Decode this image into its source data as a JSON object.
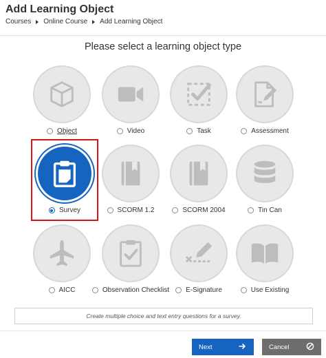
{
  "header": {
    "title": "Add Learning Object",
    "breadcrumb": [
      "Courses",
      "Online Course",
      "Add Learning Object"
    ]
  },
  "main": {
    "heading": "Please select a learning object type",
    "selected": "Survey",
    "options": [
      {
        "label": "Object",
        "icon": "cube-icon"
      },
      {
        "label": "Video",
        "icon": "video-camera-icon"
      },
      {
        "label": "Task",
        "icon": "task-checkbox-icon"
      },
      {
        "label": "Assessment",
        "icon": "assessment-edit-icon"
      },
      {
        "label": "Survey",
        "icon": "clipboard-icon"
      },
      {
        "label": "SCORM 1.2",
        "icon": "book-icon"
      },
      {
        "label": "SCORM 2004",
        "icon": "book-icon"
      },
      {
        "label": "Tin Can",
        "icon": "database-icon"
      },
      {
        "label": "AICC",
        "icon": "airplane-icon"
      },
      {
        "label": "Observation Checklist",
        "icon": "checklist-clipboard-icon"
      },
      {
        "label": "E-Signature",
        "icon": "signature-pen-icon"
      },
      {
        "label": "Use Existing",
        "icon": "open-book-icon"
      }
    ],
    "description": "Create multiple choice and text entry questions for a survey."
  },
  "footer": {
    "next_label": "Next",
    "cancel_label": "Cancel"
  },
  "colors": {
    "accent": "#1565c0",
    "selection_outline": "#d7141a",
    "icon_gray": "#bdbdbd",
    "cancel": "#6d6d6d"
  }
}
